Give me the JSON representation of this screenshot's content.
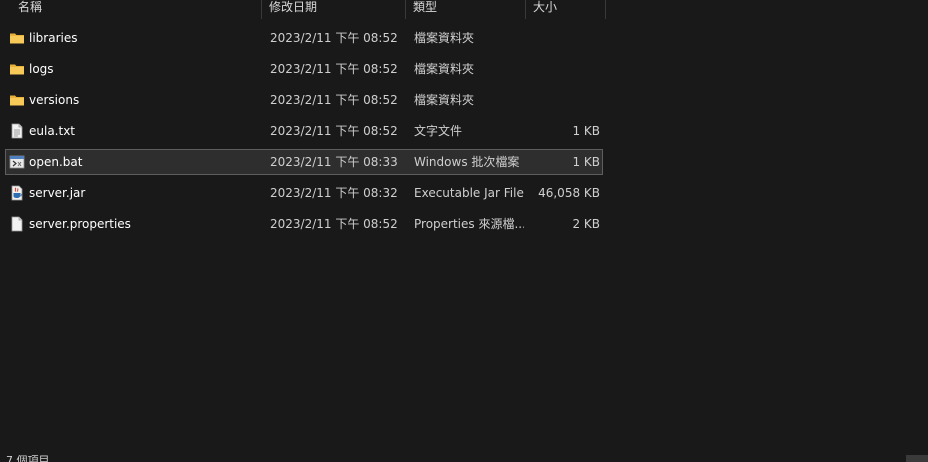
{
  "columns": {
    "name": "名稱",
    "date": "修改日期",
    "type": "類型",
    "size": "大小"
  },
  "files": [
    {
      "name": "libraries",
      "date": "2023/2/11 下午 08:52",
      "type": "檔案資料夾",
      "size": "",
      "icon": "folder-icon"
    },
    {
      "name": "logs",
      "date": "2023/2/11 下午 08:52",
      "type": "檔案資料夾",
      "size": "",
      "icon": "folder-icon"
    },
    {
      "name": "versions",
      "date": "2023/2/11 下午 08:52",
      "type": "檔案資料夾",
      "size": "",
      "icon": "folder-icon"
    },
    {
      "name": "eula.txt",
      "date": "2023/2/11 下午 08:52",
      "type": "文字文件",
      "size": "1 KB",
      "icon": "text-file-icon"
    },
    {
      "name": "open.bat",
      "date": "2023/2/11 下午 08:33",
      "type": "Windows 批次檔案",
      "size": "1 KB",
      "icon": "batch-file-icon",
      "selected": true
    },
    {
      "name": "server.jar",
      "date": "2023/2/11 下午 08:32",
      "type": "Executable Jar File",
      "size": "46,058 KB",
      "icon": "java-jar-icon"
    },
    {
      "name": "server.properties",
      "date": "2023/2/11 下午 08:52",
      "type": "Properties 來源檔...",
      "size": "2 KB",
      "icon": "file-icon"
    }
  ],
  "status": {
    "text": "7 個項目"
  },
  "colors": {
    "background": "#191919",
    "selection": "#2e2e2e",
    "folder": "#f4c44e"
  }
}
